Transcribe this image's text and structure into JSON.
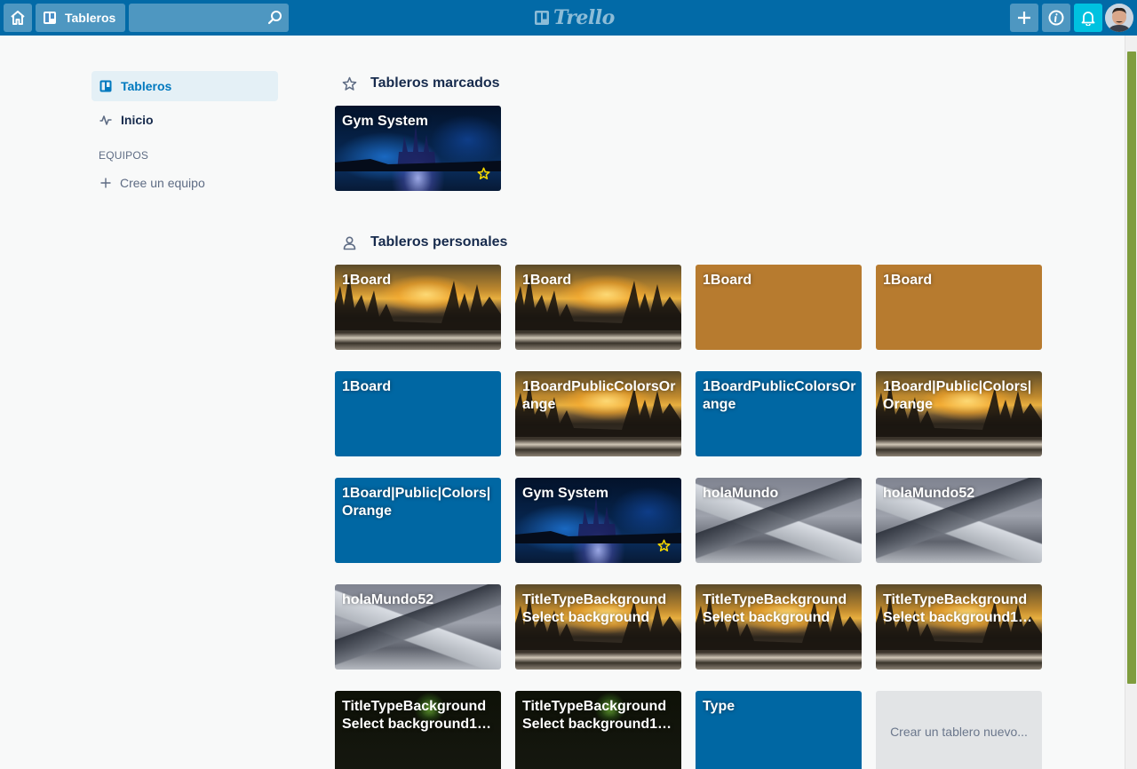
{
  "header": {
    "boards_button_label": "Tableros",
    "search_placeholder": "",
    "logo_text": "Trello"
  },
  "sidebar": {
    "items": [
      {
        "label": "Tableros",
        "icon": "board-icon",
        "active": true
      },
      {
        "label": "Inicio",
        "icon": "activity-icon",
        "active": false
      }
    ],
    "teams_heading": "EQUIPOS",
    "create_team_label": "Cree un equipo"
  },
  "starred": {
    "title": "Tableros marcados",
    "boards": [
      {
        "name": "Gym System",
        "background": "castle",
        "starred": true
      }
    ]
  },
  "personal": {
    "title": "Tableros personales",
    "boards": [
      {
        "name": "1Board",
        "background": "winter"
      },
      {
        "name": "1Board",
        "background": "winter"
      },
      {
        "name": "1Board",
        "background": "orange"
      },
      {
        "name": "1Board",
        "background": "orange"
      },
      {
        "name": "1Board",
        "background": "blue"
      },
      {
        "name": "1BoardPublicColorsOrange",
        "background": "winter"
      },
      {
        "name": "1BoardPublicColorsOrange",
        "background": "blue"
      },
      {
        "name": "1Board|Public|Colors|Orange",
        "background": "winter"
      },
      {
        "name": "1Board|Public|Colors|Orange",
        "background": "blue"
      },
      {
        "name": "Gym System",
        "background": "castle",
        "starred": true
      },
      {
        "name": "holaMundo",
        "background": "mountain"
      },
      {
        "name": "holaMundo52",
        "background": "mountain"
      },
      {
        "name": "holaMundo52",
        "background": "mountain"
      },
      {
        "name": "TitleTypeBackground Select background",
        "background": "winter"
      },
      {
        "name": "TitleTypeBackground Select background",
        "background": "winter"
      },
      {
        "name": "TitleTypeBackground Select background1…",
        "background": "winter"
      },
      {
        "name": "TitleTypeBackground Select background1…",
        "background": "fireworks"
      },
      {
        "name": "TitleTypeBackground Select background1…",
        "background": "fireworks"
      },
      {
        "name": "Type",
        "background": "blue"
      }
    ],
    "create_label": "Crear un tablero nuevo..."
  },
  "colors": {
    "header": "#026aa7",
    "board_blue": "#0067a3",
    "board_orange": "#b77b2f",
    "notification": "#00c2e0",
    "star": "#f2d600"
  }
}
